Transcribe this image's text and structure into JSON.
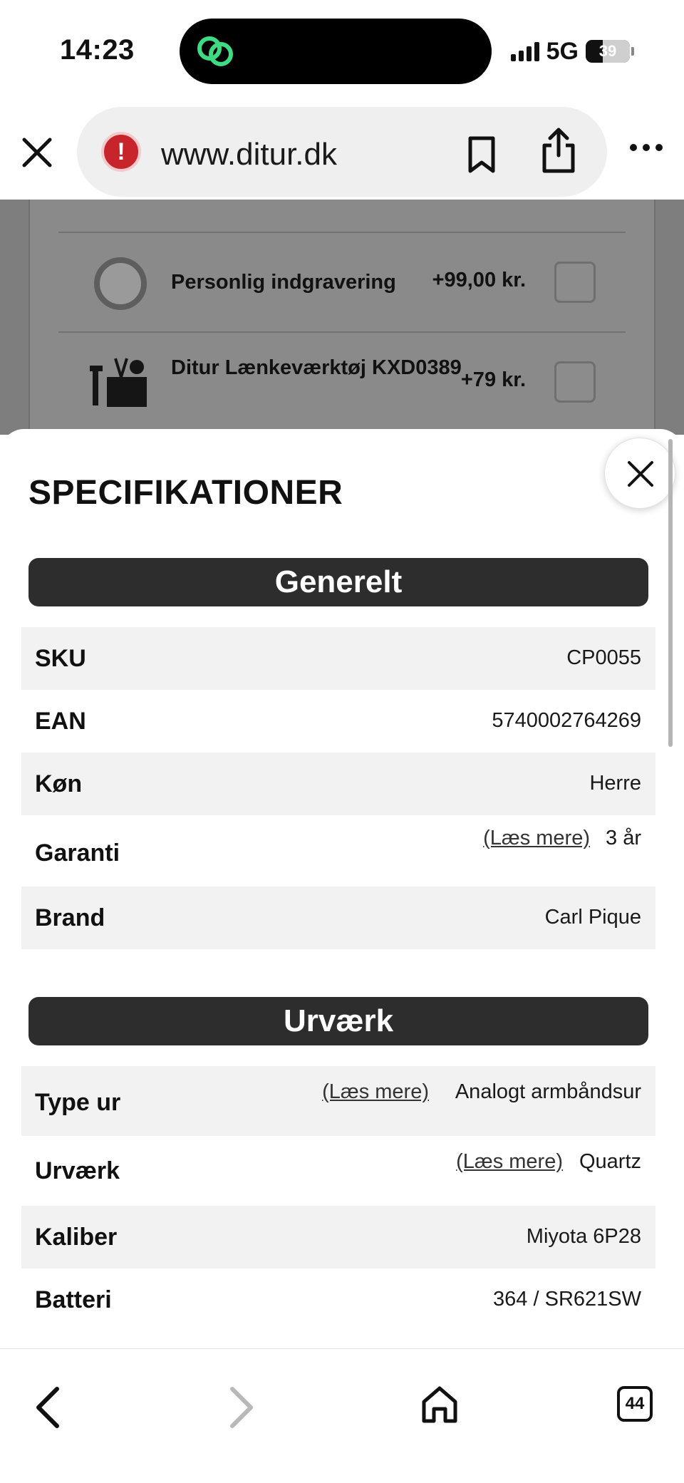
{
  "status_bar": {
    "time": "14:23",
    "network": "5G",
    "battery": "39",
    "battery_level": 0.39
  },
  "browser": {
    "url": "www.ditur.dk",
    "tab_count": "44"
  },
  "background_page": {
    "addons": [
      {
        "label": "Personlig indgravering",
        "price": "+99,00 kr."
      },
      {
        "label": "Ditur Lænkeværktøj KXD0389",
        "price": "+79 kr."
      }
    ]
  },
  "sheet": {
    "title": "SPECIFIKATIONER",
    "sections": [
      {
        "header": "Generelt",
        "rows": [
          {
            "label": "SKU",
            "value": "CP0055"
          },
          {
            "label": "EAN",
            "value": "5740002764269"
          },
          {
            "label": "Køn",
            "value": "Herre"
          },
          {
            "label": "Garanti",
            "value": "3 år",
            "link": "(Læs mere)"
          },
          {
            "label": "Brand",
            "value": "Carl Pique"
          }
        ]
      },
      {
        "header": "Urværk",
        "rows": [
          {
            "label": "Type ur",
            "value": "Analogt armbåndsur",
            "link": "(Læs mere)"
          },
          {
            "label": "Urværk",
            "value": "Quartz",
            "link": "(Læs mere)"
          },
          {
            "label": "Kaliber",
            "value": "Miyota 6P28"
          },
          {
            "label": "Batteri",
            "value": "364 / SR621SW"
          }
        ]
      }
    ]
  },
  "icons": {
    "island_app": "link-rings-icon",
    "security": "warning-icon",
    "bookmark": "bookmark-icon",
    "share": "share-icon",
    "more": "more-icon",
    "close_sheet": "close-icon",
    "back": "chevron-left-icon",
    "forward": "chevron-right-icon",
    "home": "home-icon",
    "tabs": "tabs-icon"
  },
  "colors": {
    "section_header_bg": "#2d2d2d",
    "row_shade": "#f2f2f2",
    "security_warning": "#c8242b",
    "island_icon": "#3ddc84"
  }
}
